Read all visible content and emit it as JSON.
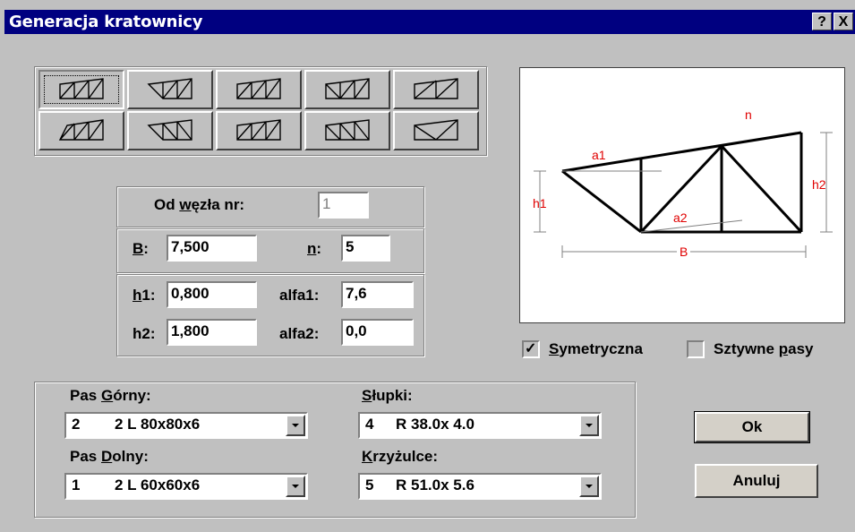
{
  "window": {
    "title": "Generacja kratownicy",
    "help_label": "?",
    "close_label": "X"
  },
  "truss_types": {
    "count": 10,
    "selected_index": 0
  },
  "node": {
    "label_pre": "Od ",
    "label_u": "w",
    "label_post": "ęzła nr:",
    "value": "1"
  },
  "B": {
    "label": "B",
    "colon": ":",
    "value": "7,500"
  },
  "n": {
    "label": "n",
    "colon": ":",
    "value": "5"
  },
  "h1": {
    "label": "h",
    "label2": "1:",
    "value": "0,800"
  },
  "h2": {
    "label": "h2:",
    "value": "1,800"
  },
  "alfa1": {
    "label": "alfa1:",
    "value": "7,6"
  },
  "alfa2": {
    "label": "alfa2:",
    "value": "0,0"
  },
  "preview": {
    "labels": {
      "n": "n",
      "a1": "a1",
      "a2": "a2",
      "h1": "h1",
      "h2": "h2",
      "B": "B"
    },
    "label_color": "#e00000"
  },
  "options": {
    "symmetric": {
      "u": "S",
      "rest": "ymetryczna",
      "checked": true
    },
    "rigid": {
      "pre": "Sztywne ",
      "u": "p",
      "rest": "asy",
      "checked": false
    }
  },
  "sections": {
    "pas_gorny": {
      "pre": "Pas ",
      "u": "G",
      "rest": "órny:",
      "num": "2",
      "value": "2 L 80x80x6"
    },
    "pas_dolny": {
      "pre": "Pas ",
      "u": "D",
      "rest": "olny:",
      "num": "1",
      "value": "2 L 60x60x6"
    },
    "slupki": {
      "pre": "",
      "u": "S",
      "rest": "łupki:",
      "num": "4",
      "value": "R 38.0x 4.0"
    },
    "krzyzulce": {
      "pre": "",
      "u": "K",
      "rest": "rzyżulce:",
      "num": "5",
      "value": "R 51.0x 5.6"
    }
  },
  "buttons": {
    "ok": "Ok",
    "cancel": "Anuluj"
  },
  "check_mark": "✓"
}
